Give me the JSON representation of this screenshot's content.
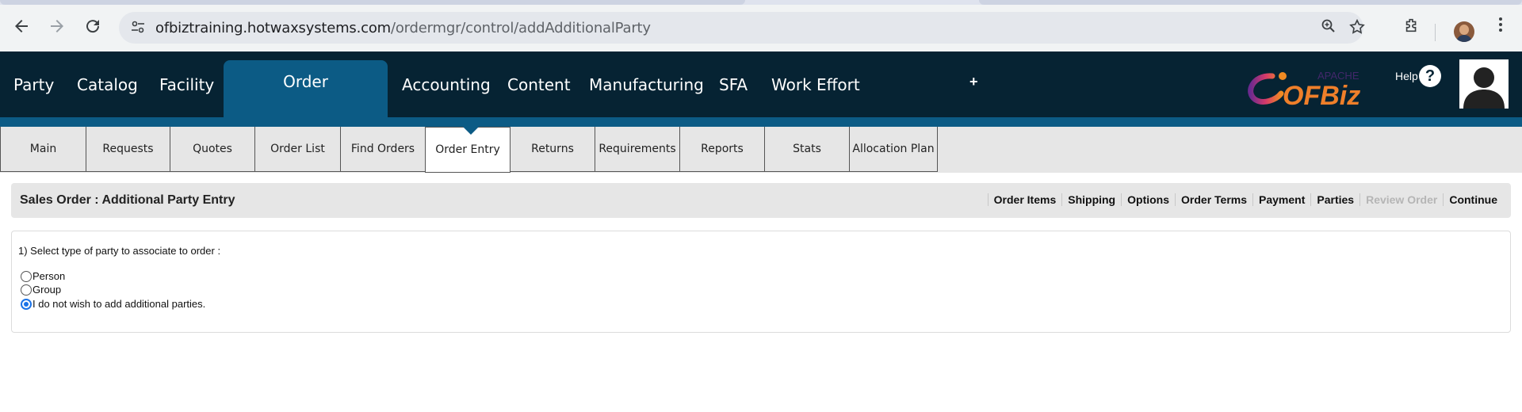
{
  "browser": {
    "url_host": "ofbiztraining.hotwaxsystems.com",
    "url_path": "/ordermgr/control/addAdditionalParty",
    "icons": [
      "back-icon",
      "forward-icon",
      "reload-icon",
      "site-info-icon",
      "zoom-icon",
      "bookmark-star-icon",
      "extensions-icon",
      "profile-avatar"
    ]
  },
  "header": {
    "nav": [
      "Party",
      "Catalog",
      "Facility",
      "Order",
      "Accounting",
      "Content",
      "Manufacturing",
      "SFA",
      "Work Effort"
    ],
    "active_nav": "Order",
    "plus": "+",
    "logo_top": "APACHE",
    "logo_main": "OFBiz",
    "help_label": "Help",
    "help_icon": "?"
  },
  "subnav": {
    "tabs": [
      "Main",
      "Requests",
      "Quotes",
      "Order List",
      "Find Orders",
      "Order Entry",
      "Returns",
      "Requirements",
      "Reports",
      "Stats",
      "Allocation Plan"
    ],
    "active": "Order Entry"
  },
  "panel": {
    "title": "Sales Order : Additional Party Entry",
    "actions": [
      {
        "label": "Order Items",
        "enabled": true
      },
      {
        "label": "Shipping",
        "enabled": true
      },
      {
        "label": "Options",
        "enabled": true
      },
      {
        "label": "Order Terms",
        "enabled": true
      },
      {
        "label": "Payment",
        "enabled": true
      },
      {
        "label": "Parties",
        "enabled": true
      },
      {
        "label": "Review Order",
        "enabled": false
      },
      {
        "label": "Continue",
        "enabled": true
      }
    ],
    "question": "1) Select type of party to associate to order :",
    "options": [
      {
        "label": "Person",
        "selected": false
      },
      {
        "label": "Group",
        "selected": false
      },
      {
        "label": "I do not wish to add additional parties.",
        "selected": true
      }
    ]
  },
  "colors": {
    "header_bg": "#062333",
    "accent_blue": "#0c5b85",
    "radio_selected": "#1a73e8"
  }
}
